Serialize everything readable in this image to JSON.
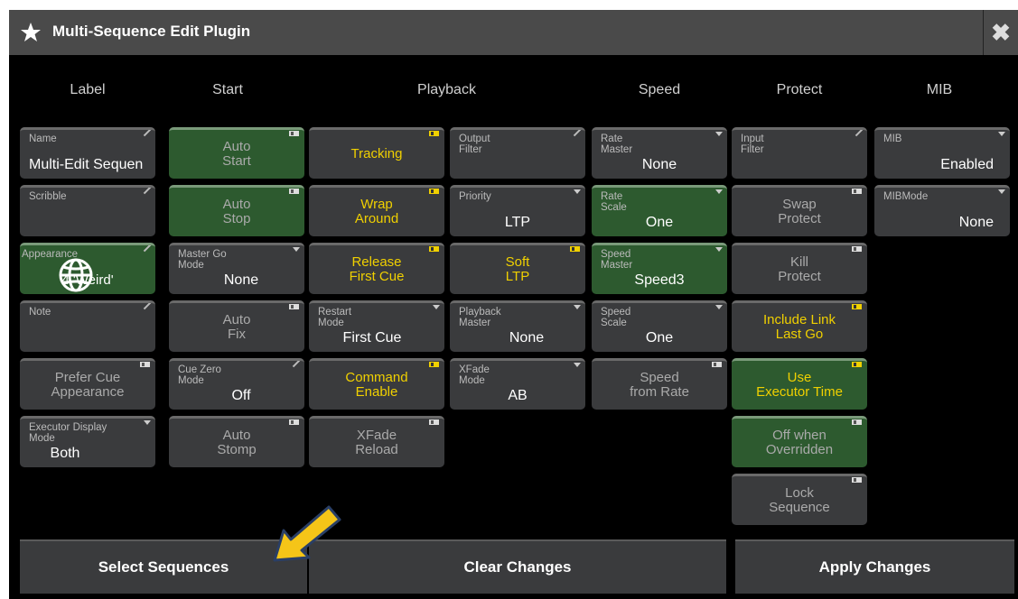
{
  "window": {
    "title": "Multi-Sequence Edit Plugin",
    "close_icon": "close-x-icon"
  },
  "columns": {
    "label": "Label",
    "start": "Start",
    "playback": "Playback",
    "speed": "Speed",
    "protect": "Protect",
    "mib": "MIB"
  },
  "label_col": {
    "name": {
      "caption": "Name",
      "value": "Multi-Edit Sequen"
    },
    "scribble": {
      "caption": "Scribble"
    },
    "appearance": {
      "caption": "Appearance",
      "value": "4 'Weird'"
    },
    "note": {
      "caption": "Note"
    },
    "prefer_cue_appearance": "Prefer Cue\nAppearance",
    "executor_display_mode": {
      "caption": "Executor Display\nMode",
      "value": "Both"
    }
  },
  "start_col": {
    "auto_start": "Auto\nStart",
    "auto_stop": "Auto\nStop",
    "master_go_mode": {
      "caption": "Master Go\nMode",
      "value": "None"
    },
    "auto_fix": "Auto\nFix",
    "cue_zero_mode": {
      "caption": "Cue Zero\nMode",
      "value": "Off"
    },
    "auto_stomp": "Auto\nStomp"
  },
  "playback_col1": {
    "tracking": "Tracking",
    "wrap_around": "Wrap\nAround",
    "release_first_cue": "Release\nFirst Cue",
    "restart_mode": {
      "caption": "Restart\nMode",
      "value": "First Cue"
    },
    "command_enable": "Command\nEnable",
    "xfade_reload": "XFade\nReload"
  },
  "playback_col2": {
    "output_filter": {
      "caption": "Output\nFilter"
    },
    "priority": {
      "caption": "Priority",
      "value": "LTP"
    },
    "soft_ltp": "Soft\nLTP",
    "playback_master": {
      "caption": "Playback\nMaster",
      "value": "None"
    },
    "xfade_mode": {
      "caption": "XFade\nMode",
      "value": "AB"
    }
  },
  "speed_col": {
    "rate_master": {
      "caption": "Rate\nMaster",
      "value": "None"
    },
    "rate_scale": {
      "caption": "Rate\nScale",
      "value": "One"
    },
    "speed_master": {
      "caption": "Speed\nMaster",
      "value": "Speed3"
    },
    "speed_scale": {
      "caption": "Speed\nScale",
      "value": "One"
    },
    "speed_from_rate": "Speed\nfrom Rate"
  },
  "protect_col": {
    "input_filter": {
      "caption": "Input\nFilter"
    },
    "swap_protect": "Swap\nProtect",
    "kill_protect": "Kill\nProtect",
    "include_link_last_go": "Include Link\nLast Go",
    "use_executor_time": "Use\nExecutor Time",
    "off_when_overridden": "Off when\nOverridden",
    "lock_sequence": "Lock\nSequence"
  },
  "mib_col": {
    "mib": {
      "caption": "MIB",
      "value": "Enabled"
    },
    "mib_mode": {
      "caption": "MIBMode",
      "value": "None"
    }
  },
  "footer": {
    "select_sequences": "Select Sequences",
    "clear_changes": "Clear Changes",
    "apply_changes": "Apply Changes"
  },
  "colors": {
    "accent_yellow": "#f0d000",
    "active_green": "#2d5a2f",
    "button_gray": "#3a3b3d",
    "pointer_arrow": "#f5c518"
  }
}
